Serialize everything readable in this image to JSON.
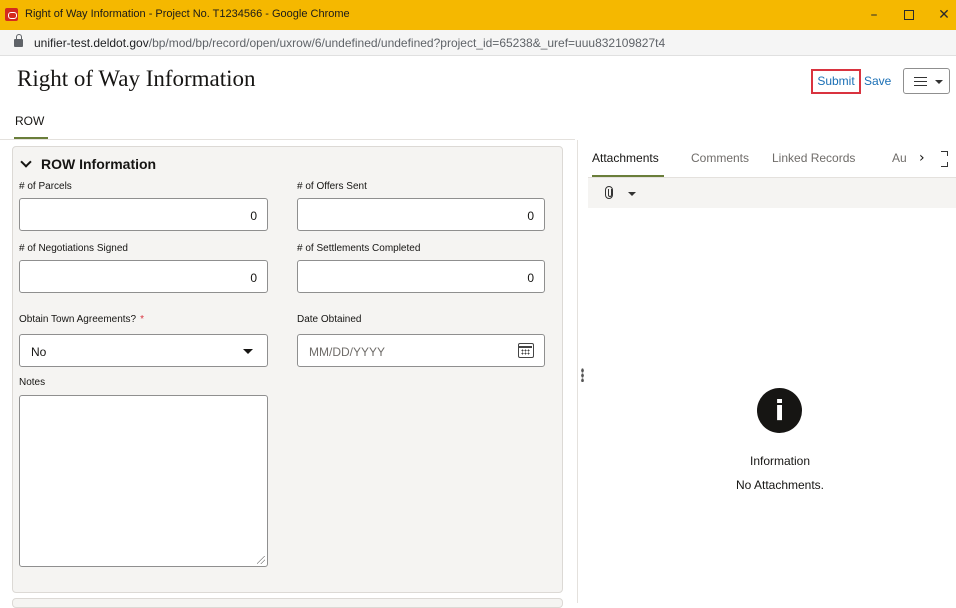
{
  "window": {
    "title": "Right of Way Information - Project No. T1234566 - Google Chrome",
    "minimize": "–",
    "close": "✕"
  },
  "address": {
    "domain": "unifier-test.deldot.gov",
    "path": "/bp/mod/bp/record/open/uxrow/6/undefined/undefined?project_id=65238&_uref=uuu832109827t4"
  },
  "header": {
    "title": "Right of Way Information",
    "submit_label": "Submit",
    "save_label": "Save"
  },
  "tabs": [
    {
      "label": "ROW"
    }
  ],
  "section": {
    "label": "ROW Information",
    "fields": {
      "parcels": {
        "label": "# of Parcels",
        "value": "0"
      },
      "offers_sent": {
        "label": "# of Offers Sent",
        "value": "0"
      },
      "negotiations_signed": {
        "label": "# of Negotiations Signed",
        "value": "0"
      },
      "settlements_completed": {
        "label": "# of Settlements Completed",
        "value": "0"
      },
      "town_agreements": {
        "label": "Obtain Town Agreements?",
        "required_mark": "*",
        "value": "No"
      },
      "date_obtained": {
        "label": "Date Obtained",
        "placeholder": "MM/DD/YYYY"
      },
      "notes": {
        "label": "Notes",
        "value": ""
      }
    }
  },
  "right_panel": {
    "tabs": [
      {
        "label": "Attachments",
        "active": true
      },
      {
        "label": "Comments"
      },
      {
        "label": "Linked Records"
      },
      {
        "label": "Au"
      }
    ],
    "next_label": "›",
    "info_glyph": "i",
    "empty_title": "Information",
    "empty_message": "No Attachments."
  }
}
